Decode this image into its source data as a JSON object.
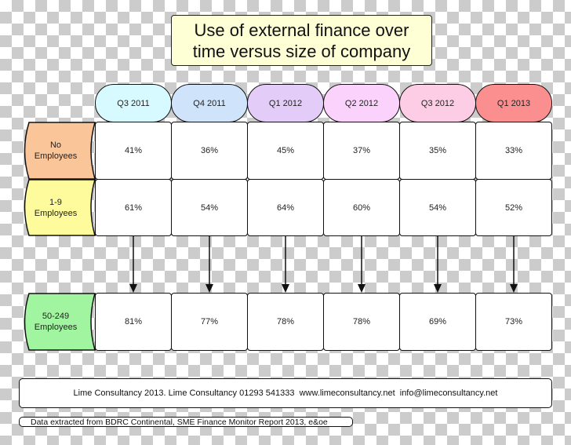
{
  "title": {
    "line1": "Use of external finance over",
    "line2": "time versus size of company"
  },
  "periods": [
    {
      "label": "Q3 2011",
      "color": "#d6faff"
    },
    {
      "label": "Q4 2011",
      "color": "#cfe4fb"
    },
    {
      "label": "Q1 2012",
      "color": "#e3cdf8"
    },
    {
      "label": "Q2 2012",
      "color": "#fbd2fb"
    },
    {
      "label": "Q3 2012",
      "color": "#fccde4"
    },
    {
      "label": "Q1 2013",
      "color": "#fb8f8f"
    }
  ],
  "rows": [
    {
      "label_line1": "No",
      "label_line2": "Employees",
      "color": "#fbc59a",
      "values": [
        "41%",
        "36%",
        "45%",
        "37%",
        "35%",
        "33%"
      ]
    },
    {
      "label_line1": "1-9",
      "label_line2": "Employees",
      "color": "#fdfb9c",
      "values": [
        "61%",
        "54%",
        "64%",
        "60%",
        "54%",
        "52%"
      ]
    },
    {
      "label_line1": "50-249",
      "label_line2": "Employees",
      "color": "#a2f5a0",
      "values": [
        "81%",
        "77%",
        "78%",
        "78%",
        "69%",
        "73%"
      ]
    }
  ],
  "footer": {
    "contact": "Lime Consultancy 2013. Lime Consultancy 01293 541333  www.limeconsultancy.net  info@limeconsultancy.net",
    "source": "Data extracted from BDRC Continental, SME Finance Monitor Report 2013, e&oe"
  }
}
